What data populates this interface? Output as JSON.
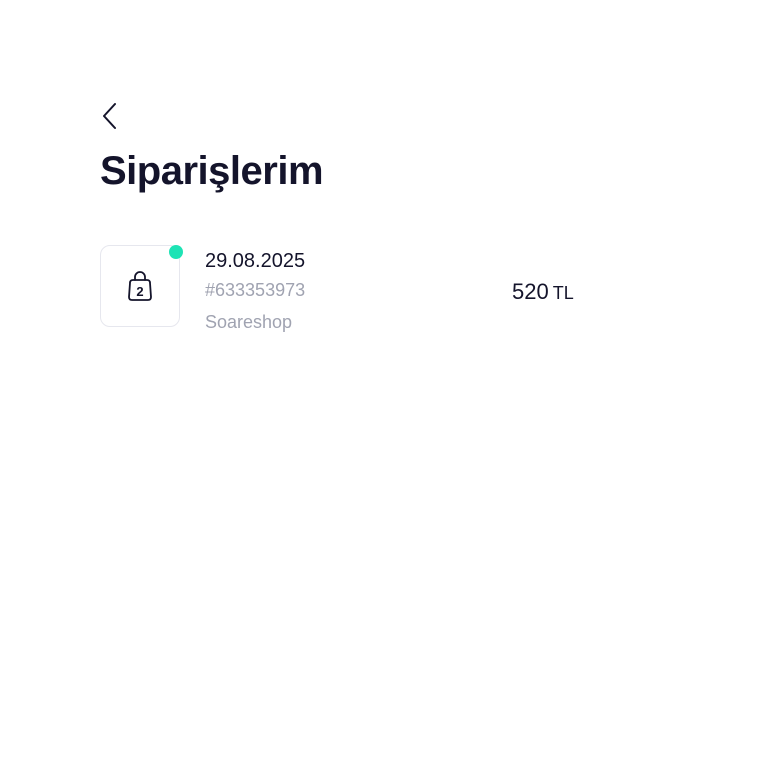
{
  "header": {
    "back_icon": "chevron-left-icon",
    "title": "Siparişlerim"
  },
  "orders": [
    {
      "date": "29.08.2025",
      "order_number": "#633353973",
      "shop": "Soareshop",
      "price_amount": "520",
      "price_currency": "TL",
      "item_count": "2",
      "icon": "shopping-bag-icon",
      "status_color": "#1ee3b5"
    }
  ],
  "colors": {
    "primary_text": "#14142b",
    "secondary_text": "#a0a3b1",
    "status_dot": "#1ee3b5",
    "border": "#e6e7ee"
  }
}
